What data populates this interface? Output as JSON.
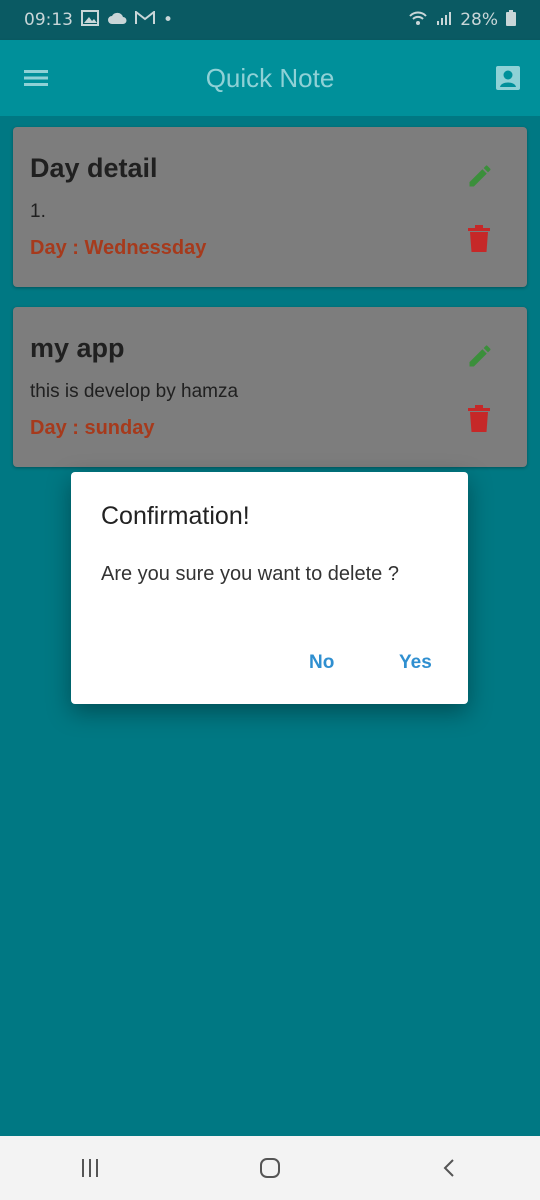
{
  "status_bar": {
    "time": "09:13",
    "notification_icons": [
      "image-icon",
      "cloud-icon",
      "gmail-icon"
    ],
    "dot": "•",
    "battery_text": "28%"
  },
  "app_bar": {
    "title": "Quick Note",
    "color": "#00909a"
  },
  "notes": [
    {
      "title": "Day detail",
      "body": "1.",
      "day": "Day : Wednessday"
    },
    {
      "title": "my app",
      "body": "this is develop by hamza",
      "day": "Day : sunday"
    }
  ],
  "dialog": {
    "title": "Confirmation!",
    "message": "Are you sure you want to delete ?",
    "no_label": "No",
    "yes_label": "Yes",
    "button_color": "#2f8fd0"
  },
  "colors": {
    "edit_icon": "#3b8f3b",
    "delete_icon": "#c62828",
    "day_text": "#a63a1c"
  },
  "nav_bar": {
    "icons": [
      "recent-apps-icon",
      "home-icon",
      "back-icon"
    ]
  }
}
